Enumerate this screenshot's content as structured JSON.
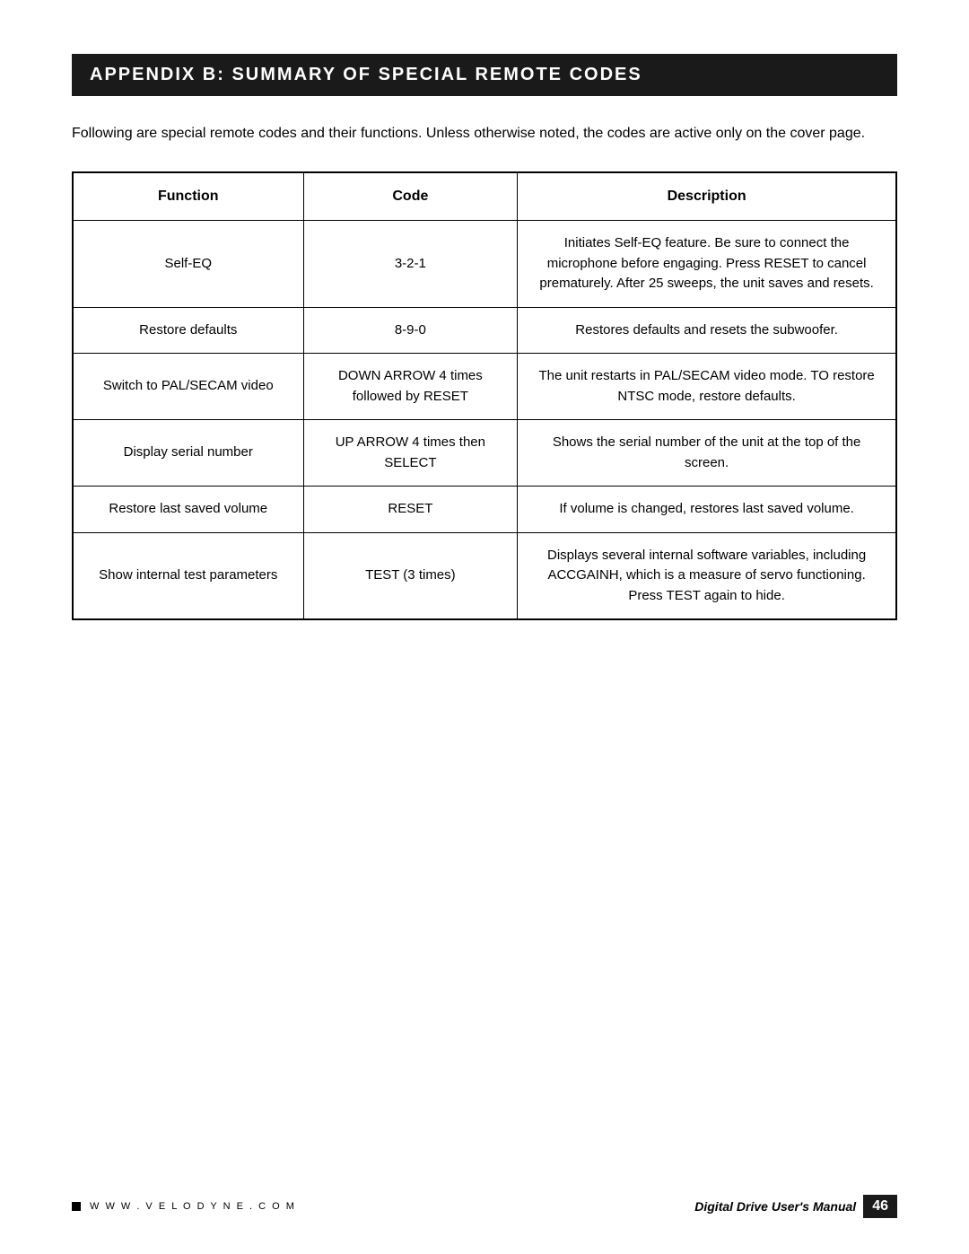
{
  "page": {
    "title": "Appendix B: Summary of Special Remote Codes",
    "intro": "Following are special remote codes and their functions.  Unless otherwise noted, the codes are active only on the cover page.",
    "table": {
      "headers": [
        "Function",
        "Code",
        "Description"
      ],
      "rows": [
        {
          "function": "Self-EQ",
          "code": "3-2-1",
          "description": "Initiates Self-EQ feature. Be sure to connect the microphone before engaging. Press RESET to cancel prematurely. After 25 sweeps, the unit saves and resets."
        },
        {
          "function": "Restore defaults",
          "code": "8-9-0",
          "description": "Restores defaults and resets the subwoofer."
        },
        {
          "function": "Switch to PAL/SECAM video",
          "code": "DOWN ARROW 4 times followed by RESET",
          "description": "The unit restarts in PAL/SECAM video mode. TO restore NTSC mode, restore defaults."
        },
        {
          "function": "Display serial number",
          "code": "UP ARROW 4 times then SELECT",
          "description": "Shows the serial number of the unit at the top of the screen."
        },
        {
          "function": "Restore last saved volume",
          "code": "RESET",
          "description": "If volume is changed, restores last saved volume."
        },
        {
          "function": "Show internal test parameters",
          "code": "TEST (3 times)",
          "description": "Displays several internal software variables, including ACCGAINH, which is a measure of servo functioning. Press TEST again to hide."
        }
      ]
    },
    "footer": {
      "website": "W W W . V E L O D Y N E . C O M",
      "manual_label": "Digital Drive User's Manual",
      "page_number": "46"
    }
  }
}
